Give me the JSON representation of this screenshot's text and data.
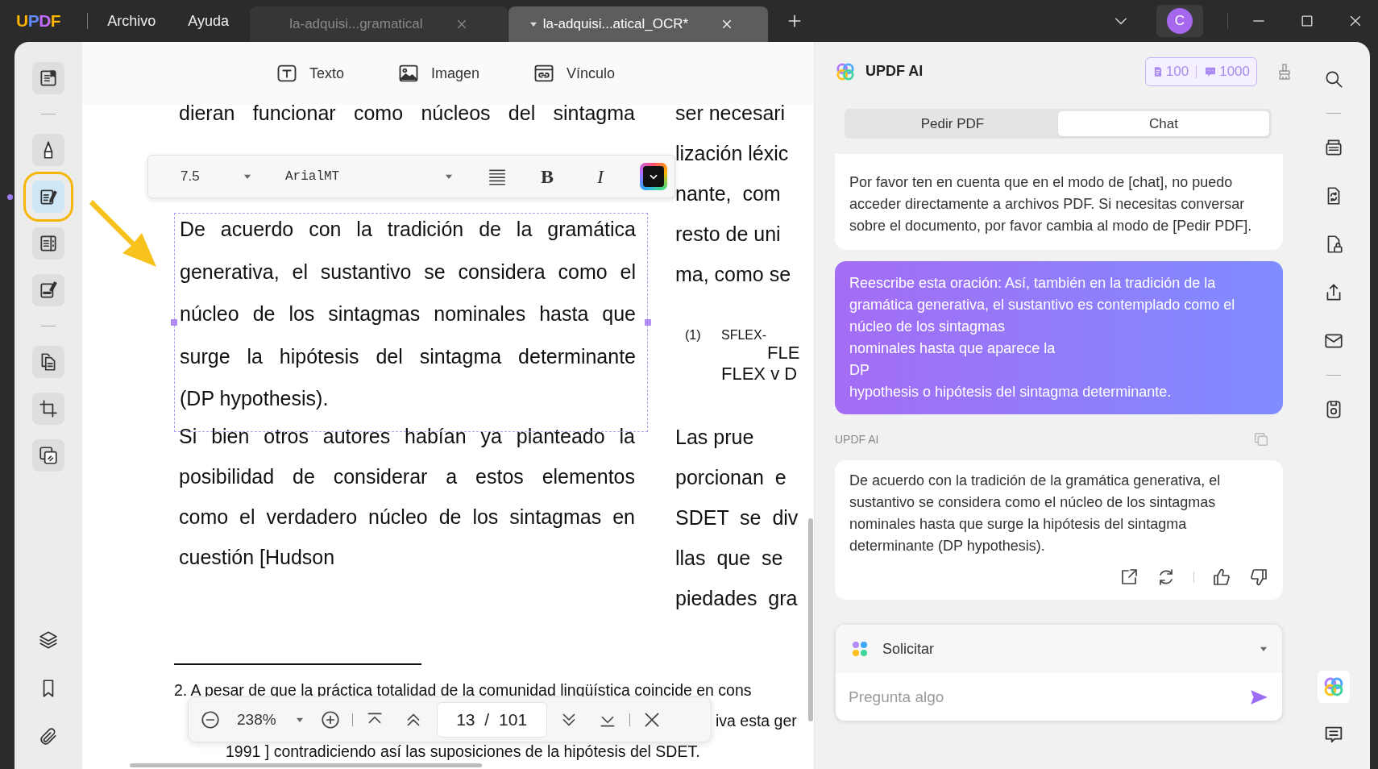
{
  "title_bar": {
    "logo": "UPDF",
    "menus": [
      "Archivo",
      "Ayuda"
    ],
    "tabs": [
      {
        "label": "la-adquisi...gramatical",
        "selected": false
      },
      {
        "label": "la-adquisi...atical_OCR*",
        "selected": true
      }
    ],
    "avatar": "C"
  },
  "left_toolbar": {
    "groups": [
      [
        {
          "kind": "reader",
          "selected": false
        }
      ],
      [
        {
          "kind": "comment",
          "selected": false
        },
        {
          "kind": "edit",
          "selected": true
        },
        {
          "kind": "form",
          "selected": false
        },
        {
          "kind": "fill",
          "selected": false
        }
      ],
      [
        {
          "kind": "organize",
          "selected": false
        },
        {
          "kind": "crop",
          "selected": false
        },
        {
          "kind": "overlay",
          "selected": false
        }
      ]
    ],
    "bottom": [
      {
        "kind": "layers"
      },
      {
        "kind": "bookmark"
      },
      {
        "kind": "attachment"
      }
    ]
  },
  "edit_toolbar": [
    {
      "kind": "text",
      "label": "Texto"
    },
    {
      "kind": "image",
      "label": "Imagen"
    },
    {
      "kind": "link",
      "label": "Vínculo"
    }
  ],
  "format_bar": {
    "font_size": "7.5",
    "font": "ArialMT",
    "bold": "B",
    "italic": "I"
  },
  "document": {
    "left_column": [
      {
        "selected": false,
        "lines": [
          "dieran funcionar como núcleos del sintagma"
        ]
      },
      {
        "selected": true,
        "lines": [
          "De acuerdo con la tradición de la gramática",
          "generativa, el sustantivo se considera como el",
          "núcleo de los sintagmas nominales hasta que",
          "surge la hipótesis del sintagma determinante",
          "(DP hypothesis)."
        ]
      },
      {
        "selected": false,
        "lines": [
          "Si bien otros autores habían ya planteado la",
          "posibilidad de considerar a estos elementos",
          "como el verdadero núcleo de los sintagmas en",
          "cuestión [Hudson"
        ]
      }
    ],
    "right_column": [
      {
        "kind": "paragraph",
        "lines": [
          "ser necesari",
          "lización léxic",
          "nante,  com",
          "resto de uni",
          "ma, como se"
        ]
      },
      {
        "kind": "example",
        "number": "(1)",
        "lines": [
          "SFLEX-",
          "FLE",
          "FLEX v D"
        ]
      },
      {
        "kind": "paragraph",
        "lines": [
          "Las prue",
          "porcionan  e",
          "SDET  se  div",
          "llas  que  se",
          "piedades  gra"
        ]
      }
    ],
    "footnote": [
      "2. A pesar de que la práctica totalidad de la comunidad lingüística coincide en cons",
      "iva esta ger",
      "1991 ] contradiciendo así las suposiciones de la hipótesis del SDET."
    ]
  },
  "zoom_bar": {
    "zoom": "238%",
    "page": "13 / 101"
  },
  "ai_panel": {
    "title": "UPDF AI",
    "credits": [
      {
        "kind": "document",
        "count": "100"
      },
      {
        "kind": "chat",
        "count": "1000"
      }
    ],
    "modes": [
      {
        "label": "Pedir PDF",
        "selected": false
      },
      {
        "label": "Chat",
        "selected": true
      }
    ],
    "messages": [
      {
        "kind": "assistant",
        "actions": false,
        "text": "Por favor ten en cuenta que en el modo de [chat], no puedo acceder directamente a archivos PDF. Si necesitas conversar sobre el documento, por favor cambia al modo de [Pedir PDF]."
      },
      {
        "kind": "user",
        "actions": false,
        "text": "Reescribe esta oración: Así, también en la tradición de la gramática generativa, el sustantivo es contemplado como el núcleo de los sintagmas\nnominales hasta que aparece la\nDP\nhypothesis o hipótesis del sintagma determinante."
      },
      {
        "kind": "assistant",
        "sender": "UPDF AI",
        "actions": true,
        "text": "De acuerdo con la tradición de la gramática generativa, el sustantivo se considera como el núcleo de los sintagmas nominales hasta que surge la hipótesis del sintagma determinante (DP hypothesis)."
      }
    ],
    "prompt": {
      "label": "Solicitar",
      "placeholder": "Pregunta algo"
    }
  },
  "right_toolbar": {
    "groups": [
      [
        {
          "kind": "search"
        }
      ],
      [
        {
          "kind": "ocr"
        },
        {
          "kind": "convert"
        },
        {
          "kind": "protect"
        },
        {
          "kind": "share"
        },
        {
          "kind": "mail"
        }
      ],
      [
        {
          "kind": "save"
        }
      ]
    ],
    "bottom": [
      {
        "kind": "ai"
      },
      {
        "kind": "comment"
      }
    ]
  }
}
